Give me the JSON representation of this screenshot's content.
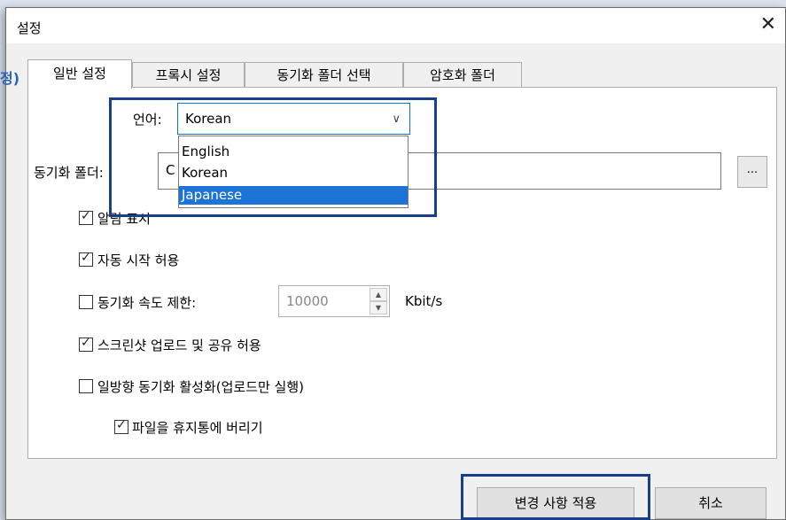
{
  "window": {
    "title": "설정",
    "close_symbol": "✕"
  },
  "edge_label": "정)",
  "tabs": [
    "일반 설정",
    "프록시 설정",
    "동기화 폴더 선택",
    "암호화 폴더"
  ],
  "language": {
    "label": "언어:",
    "selected": "Korean",
    "options": [
      "English",
      "Korean",
      "Japanese"
    ],
    "highlighted": "Japanese"
  },
  "sync_folder": {
    "label": "동기화 폴더:",
    "value": "C",
    "browse_label": "..."
  },
  "options": {
    "notification": {
      "label": "알림 표시",
      "checked": true
    },
    "autostart": {
      "label": "자동 시작 허용",
      "checked": true
    },
    "speed_limit": {
      "label": "동기화 속도 제한:",
      "checked": false,
      "value": "10000",
      "unit": "Kbit/s"
    },
    "screenshot": {
      "label": "스크린샷 업로드 및 공유 허용",
      "checked": true
    },
    "oneway": {
      "label": "일방향 동기화 활성화(업로드만 실행)",
      "checked": false
    },
    "trash": {
      "label": "파일을 휴지통에 버리기",
      "checked": true
    }
  },
  "buttons": {
    "apply": "변경 사항 적용",
    "cancel": "취소"
  },
  "icons": {
    "close": "close-icon",
    "dropdown": "chevron-down-icon",
    "spin_up": "arrow-up-icon",
    "spin_down": "arrow-down-icon",
    "check": "checkmark-icon"
  },
  "colors": {
    "accent": "#1e74d6",
    "highlight_box": "#1a3f8a",
    "edge_label": "#2a63b8"
  }
}
